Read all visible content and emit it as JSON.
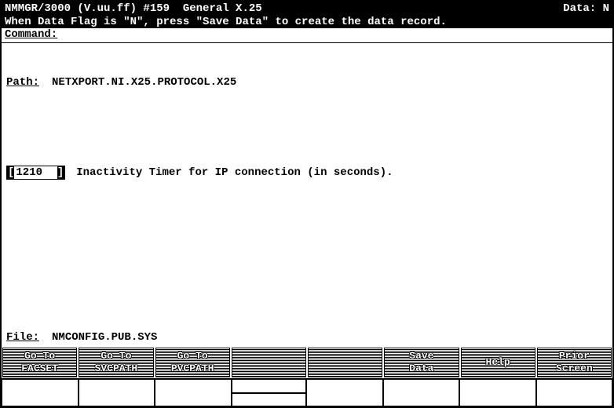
{
  "title": {
    "left": "NMMGR/3000 (V.uu.ff) #159  General X.25",
    "right": "Data: N"
  },
  "info": "When Data Flag is \"N\", press \"Save Data\" to create the data record.",
  "command": {
    "label": "Command:",
    "value": ""
  },
  "path": {
    "label": "Path:",
    "value": "NETXPORT.NI.X25.PROTOCOL.X25"
  },
  "field": {
    "value": "1210  ",
    "label": "Inactivity Timer for IP connection (in seconds)."
  },
  "file": {
    "label": "File:",
    "value": "NMCONFIG.PUB.SYS"
  },
  "fkeys": [
    {
      "line1": "Go To",
      "line2": "FACSET"
    },
    {
      "line1": "Go To",
      "line2": "SVCPATH"
    },
    {
      "line1": "Go To",
      "line2": "PVCPATH"
    },
    {
      "line1": "",
      "line2": ""
    },
    {
      "line1": "",
      "line2": ""
    },
    {
      "line1": "Save",
      "line2": "Data"
    },
    {
      "line1": "Help",
      "line2": ""
    },
    {
      "line1": "Prior",
      "line2": "Screen"
    }
  ]
}
